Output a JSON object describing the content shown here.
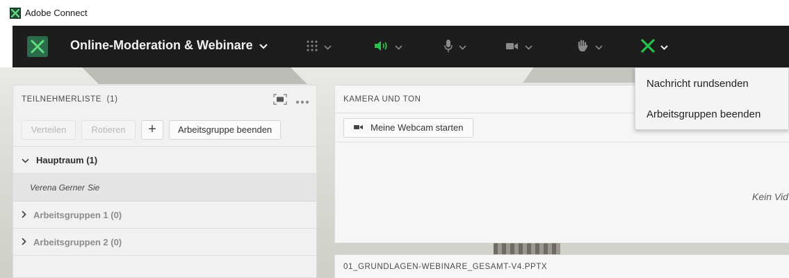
{
  "window": {
    "title": "Adobe Connect"
  },
  "toolbar": {
    "room_title": "Online-Moderation & Webinare",
    "buttons": [
      {
        "name": "layouts",
        "icon": "grid-icon"
      },
      {
        "name": "speaker",
        "icon": "speaker-icon"
      },
      {
        "name": "microphone",
        "icon": "microphone-icon"
      },
      {
        "name": "camera",
        "icon": "camera-icon"
      },
      {
        "name": "raise-hand",
        "icon": "hand-icon"
      },
      {
        "name": "breakout-rooms",
        "icon": "breakout-icon"
      }
    ],
    "colors": {
      "background": "#1d1d1d",
      "accent_green": "#27c24c",
      "icon_gray": "#8a8a8a"
    }
  },
  "breakout_menu": {
    "items": [
      "Nachricht rundsenden",
      "Arbeitsgruppen beenden"
    ]
  },
  "participants": {
    "title": "TEILNEHMERLISTE",
    "count": "(1)",
    "buttons": {
      "distribute": "Verteilen",
      "rotate": "Rotieren",
      "add": "+",
      "end_groups": "Arbeitsgruppe beenden"
    },
    "main_room": {
      "label": "Hauptraum (1)",
      "member": "Verena Gerner",
      "member_suffix": "Sie"
    },
    "groups": [
      "Arbeitsgruppen 1 (0)",
      "Arbeitsgruppen 2 (0)"
    ]
  },
  "camera": {
    "title": "KAMERA UND TON",
    "start_webcam": "Meine Webcam starten",
    "no_video": "Kein Vid"
  },
  "share": {
    "title": "01_GRUNDLAGEN-WEBINARE_GESAMT-V4.PPTX"
  }
}
